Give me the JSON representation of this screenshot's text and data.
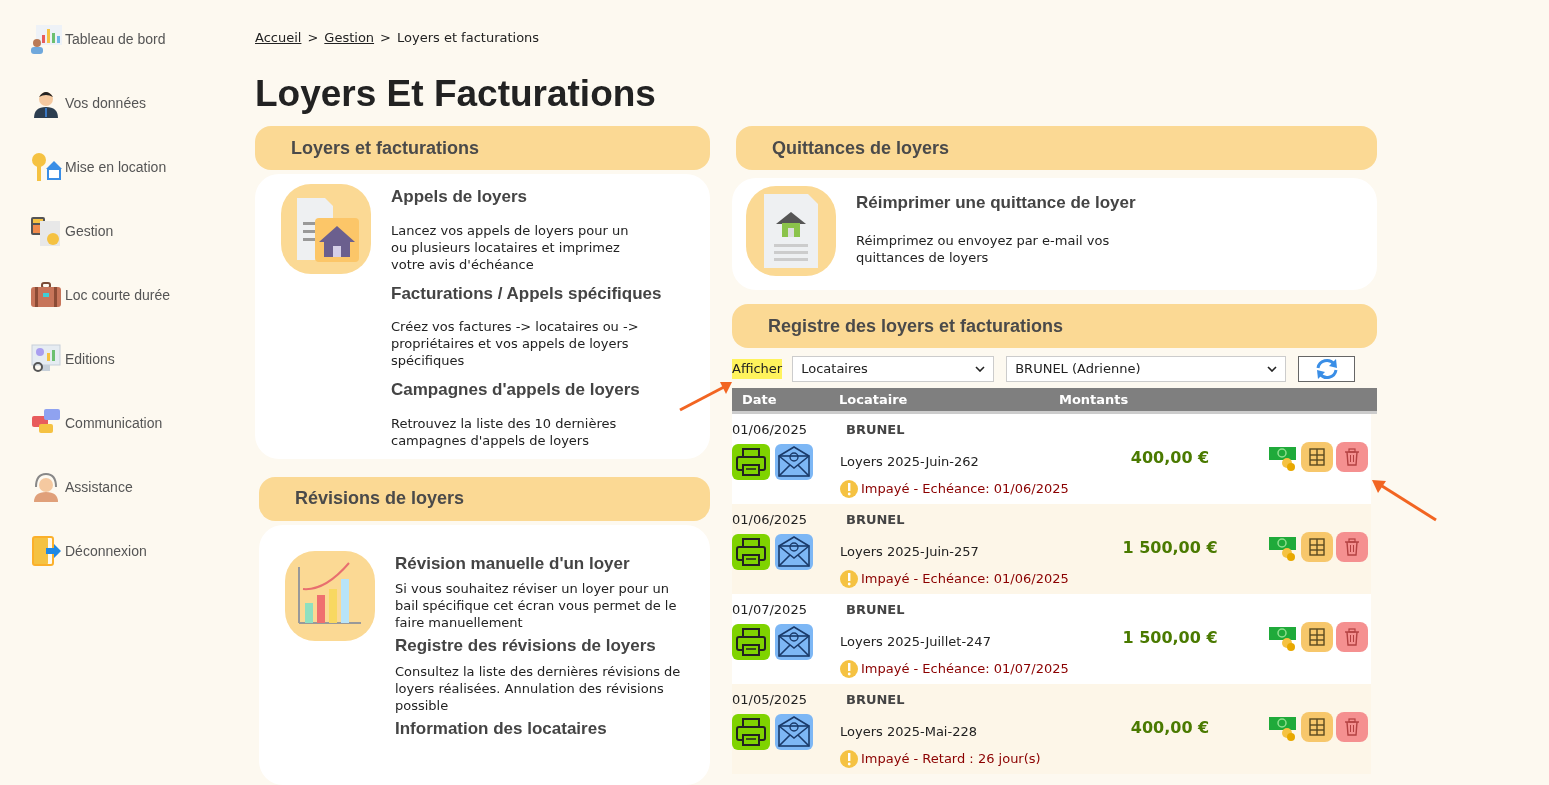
{
  "sidebar": {
    "items": [
      {
        "label": "Tableau de bord"
      },
      {
        "label": "Vos données"
      },
      {
        "label": "Mise en location"
      },
      {
        "label": "Gestion"
      },
      {
        "label": "Loc courte durée"
      },
      {
        "label": "Editions"
      },
      {
        "label": "Communication"
      },
      {
        "label": "Assistance"
      },
      {
        "label": "Déconnexion"
      }
    ]
  },
  "breadcrumb": {
    "links": [
      "Accueil",
      "Gestion"
    ],
    "separator": ">",
    "current": "Loyers et facturations"
  },
  "page_title": "Loyers Et Facturations",
  "left_sections": [
    {
      "title": "Loyers et facturations",
      "items": [
        {
          "title": "Appels de loyers",
          "text": "Lancez vos appels de loyers pour un ou plusieurs locataires et imprimez votre avis d'échéance"
        },
        {
          "title": "Facturations / Appels spécifiques",
          "text": "Créez vos factures -> locataires ou -> propriétaires et vos appels de loyers spécifiques"
        },
        {
          "title": "Campagnes d'appels de loyers",
          "text": "Retrouvez la liste des 10 dernières campagnes d'appels de loyers"
        }
      ]
    },
    {
      "title": "Révisions de loyers",
      "items": [
        {
          "title": "Révision manuelle d'un loyer",
          "text": "Si vous souhaitez réviser un loyer pour un bail spécifique cet écran vous permet de le faire manuellement"
        },
        {
          "title": "Registre des révisions de loyers",
          "text": "Consultez la liste des dernières révisions de loyers réalisées. Annulation des révisions possible"
        },
        {
          "title": "Information des locataires"
        }
      ]
    }
  ],
  "quittances": {
    "title": "Quittances de loyers",
    "item": {
      "title": "Réimprimer une quittance de loyer",
      "text": "Réimprimez ou envoyez par e-mail vos quittances de loyers"
    }
  },
  "registre": {
    "title": "Registre des loyers et facturations",
    "filter_label": "Afficher",
    "filter_type": "Locataires",
    "filter_tenant": "BRUNEL (Adrienne)",
    "columns": [
      "Date",
      "Locataire",
      "Montants"
    ],
    "rows": [
      {
        "date": "01/06/2025",
        "tenant": "BRUNEL",
        "label": "Loyers 2025-Juin-262",
        "status": "Impayé - Echéance: 01/06/2025",
        "amount": "400,00 €"
      },
      {
        "date": "01/06/2025",
        "tenant": "BRUNEL",
        "label": "Loyers 2025-Juin-257",
        "status": "Impayé - Echéance: 01/06/2025",
        "amount": "1 500,00 €"
      },
      {
        "date": "01/07/2025",
        "tenant": "BRUNEL",
        "label": "Loyers 2025-Juillet-247",
        "status": "Impayé - Echéance: 01/07/2025",
        "amount": "1 500,00 €"
      },
      {
        "date": "01/05/2025",
        "tenant": "BRUNEL",
        "label": "Loyers 2025-Mai-228",
        "status": "Impayé - Retard : 26 jour(s)",
        "amount": "400,00 €"
      }
    ]
  }
}
